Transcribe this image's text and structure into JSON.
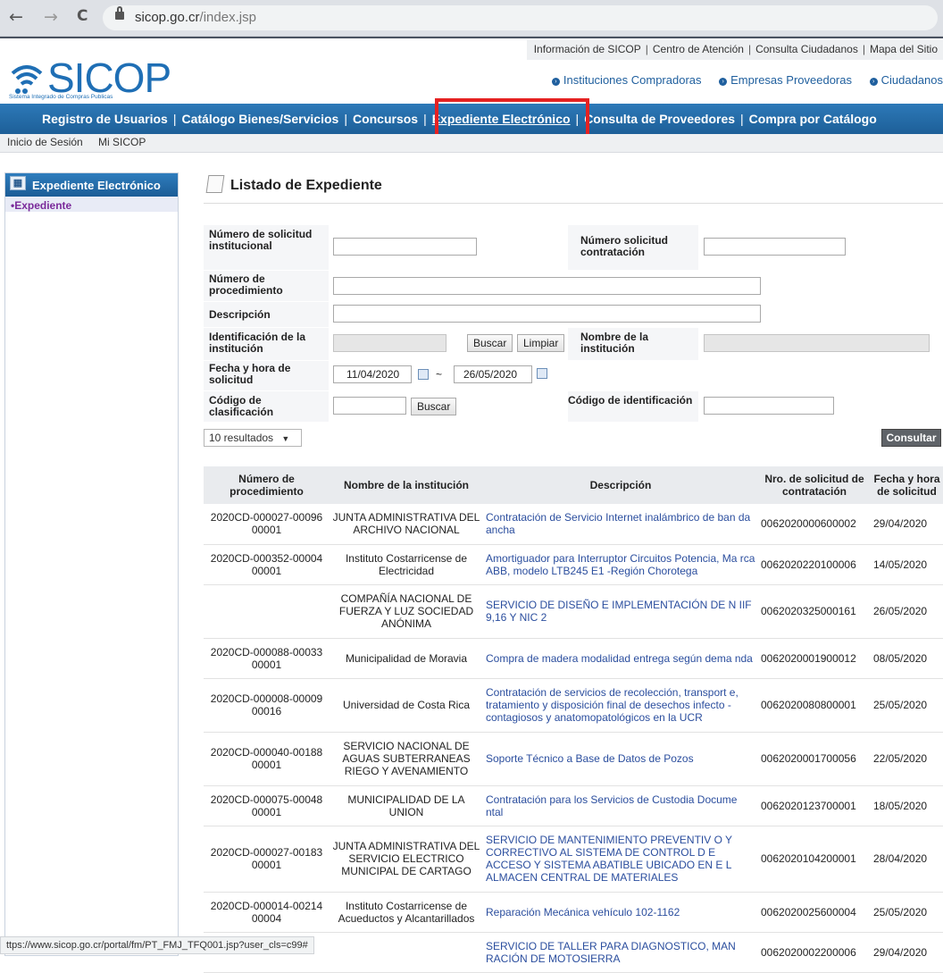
{
  "browser": {
    "back": "←",
    "forward": "→",
    "reload": "C",
    "url_domain": "sicop.go.cr",
    "url_path": "/index.jsp"
  },
  "toplinks": [
    "Información de SICOP",
    "Centro de Atención",
    "Consulta Ciudadanos",
    "Mapa del Sitio"
  ],
  "logo": {
    "text": "SICOP",
    "subtitle": "Sistema Integrado de Compras Publicas"
  },
  "roles": [
    "Instituciones Compradoras",
    "Empresas Proveedoras",
    "Ciudadanos"
  ],
  "mainnav": [
    "Registro de Usuarios",
    "Catálogo Bienes/Servicios",
    "Concursos",
    "Expediente Electrónico",
    "Consulta de Proveedores",
    "Compra por Catálogo"
  ],
  "subnav": {
    "login": "Inicio de Sesión",
    "my": "Mi SICOP"
  },
  "sidebar": {
    "title": "Expediente Electrónico",
    "item": "Expediente"
  },
  "page_title": "Listado de Expediente",
  "form": {
    "num_solicitud_inst": "Número de solicitud institucional",
    "num_solicitud_contr": "Número solicitud contratación",
    "num_procedimiento": "Número de procedimiento",
    "descripcion": "Descripción",
    "id_institucion": "Identificación de la institución",
    "nombre_institucion": "Nombre de la institución",
    "fecha_hora": "Fecha y hora de solicitud",
    "fecha_desde": "11/04/2020",
    "tilde": "~",
    "fecha_hasta": "26/05/2020",
    "cod_clasificacion": "Código de clasificación",
    "cod_identificacion": "Código de identificación",
    "buscar": "Buscar",
    "limpiar": "Limpiar",
    "buscar2": "Buscar"
  },
  "results_select": "10 resultados",
  "consultar": "Consultar",
  "table": {
    "headers": [
      "Número de procedimiento",
      "Nombre de la institución",
      "Descripción",
      "Nro. de solicitud de contratación",
      "Fecha y hora de solicitud"
    ],
    "rows": [
      {
        "proc": "2020CD-000027-00096 00001",
        "inst": "JUNTA ADMINISTRATIVA DEL ARCHIVO NACIONAL",
        "desc": "Contratación de Servicio Internet inalámbrico de ban da ancha",
        "nro": "0062020000600002",
        "fecha": "29/04/2020"
      },
      {
        "proc": "2020CD-000352-00004 00001",
        "inst": "Instituto Costarricense de Electricidad",
        "desc": "Amortiguador para Interruptor Circuitos Potencia, Ma rca ABB, modelo LTB245 E1 -Región Chorotega",
        "nro": "0062020220100006",
        "fecha": "14/05/2020"
      },
      {
        "proc": "",
        "inst": "COMPAÑÍA NACIONAL DE FUERZA Y LUZ SOCIEDAD ANÓNIMA",
        "desc": "SERVICIO DE DISEÑO E IMPLEMENTACIÓN DE N IIF 9,16 Y NIC 2",
        "nro": "0062020325000161",
        "fecha": "26/05/2020"
      },
      {
        "proc": "2020CD-000088-00033 00001",
        "inst": "Municipalidad de Moravia",
        "desc": "Compra de madera modalidad entrega según dema nda",
        "nro": "0062020001900012",
        "fecha": "08/05/2020"
      },
      {
        "proc": "2020CD-000008-00009 00016",
        "inst": "Universidad de Costa Rica",
        "desc": "Contratación de servicios de recolección, transport e, tratamiento y disposición final de desechos infecto -contagiosos y anatomopatológicos en la UCR",
        "nro": "0062020080800001",
        "fecha": "25/05/2020"
      },
      {
        "proc": "2020CD-000040-00188 00001",
        "inst": "SERVICIO NACIONAL DE AGUAS SUBTERRANEAS RIEGO Y AVENAMIENTO",
        "desc": "Soporte Técnico a Base de Datos de Pozos",
        "nro": "0062020001700056",
        "fecha": "22/05/2020"
      },
      {
        "proc": "2020CD-000075-00048 00001",
        "inst": "MUNICIPALIDAD DE LA UNION",
        "desc": "Contratación para los Servicios de Custodia Docume ntal",
        "nro": "0062020123700001",
        "fecha": "18/05/2020"
      },
      {
        "proc": "2020CD-000027-00183 00001",
        "inst": "JUNTA ADMINISTRATIVA DEL SERVICIO ELECTRICO MUNICIPAL DE CARTAGO",
        "desc": "SERVICIO DE MANTENIMIENTO PREVENTIV O Y CORRECTIVO AL SISTEMA DE CONTROL D E ACCESO Y SISTEMA ABATIBLE UBICADO EN E L ALMACEN CENTRAL DE MATERIALES",
        "nro": "0062020104200001",
        "fecha": "28/04/2020"
      },
      {
        "proc": "2020CD-000014-00214 00004",
        "inst": "Instituto Costarricense de Acueductos y Alcantarillados",
        "desc": "Reparación Mecánica vehículo 102-1162",
        "nro": "0062020025600004",
        "fecha": "25/05/2020"
      },
      {
        "proc": "",
        "inst": "",
        "desc": "SERVICIO DE TALLER PARA DIAGNOSTICO, MAN RACIÓN DE MOTOSIERRA",
        "nro": "0062020002200006",
        "fecha": "29/04/2020"
      }
    ]
  },
  "status_url": "ttps://www.sicop.go.cr/portal/fm/PT_FMJ_TFQ001.jsp?user_cls=c99#"
}
